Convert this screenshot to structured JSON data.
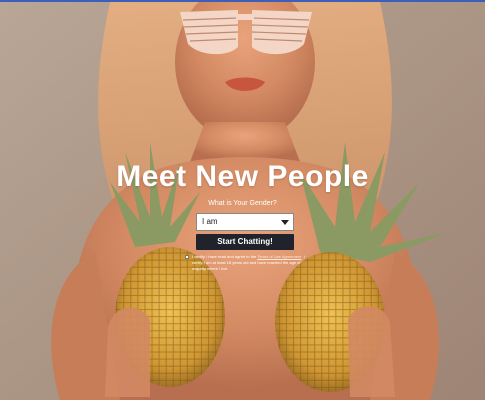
{
  "hero": {
    "headline": "Meet New People",
    "gender_label": "What is Your Gender?",
    "gender_select": {
      "selected": "I am",
      "arrow_icon": "caret-down-icon"
    },
    "cta_label": "Start Chatting!",
    "consent": {
      "prefix": "I certify I have read and agree to the",
      "link_text": "Terms of Use Agreement",
      "suffix": ". I certify I am at least 18 years old and have reached the age of majority where I live."
    }
  },
  "colors": {
    "accent_bar": "#3d5fb8",
    "button_bg": "#20232b",
    "headline": "#ffffff"
  }
}
